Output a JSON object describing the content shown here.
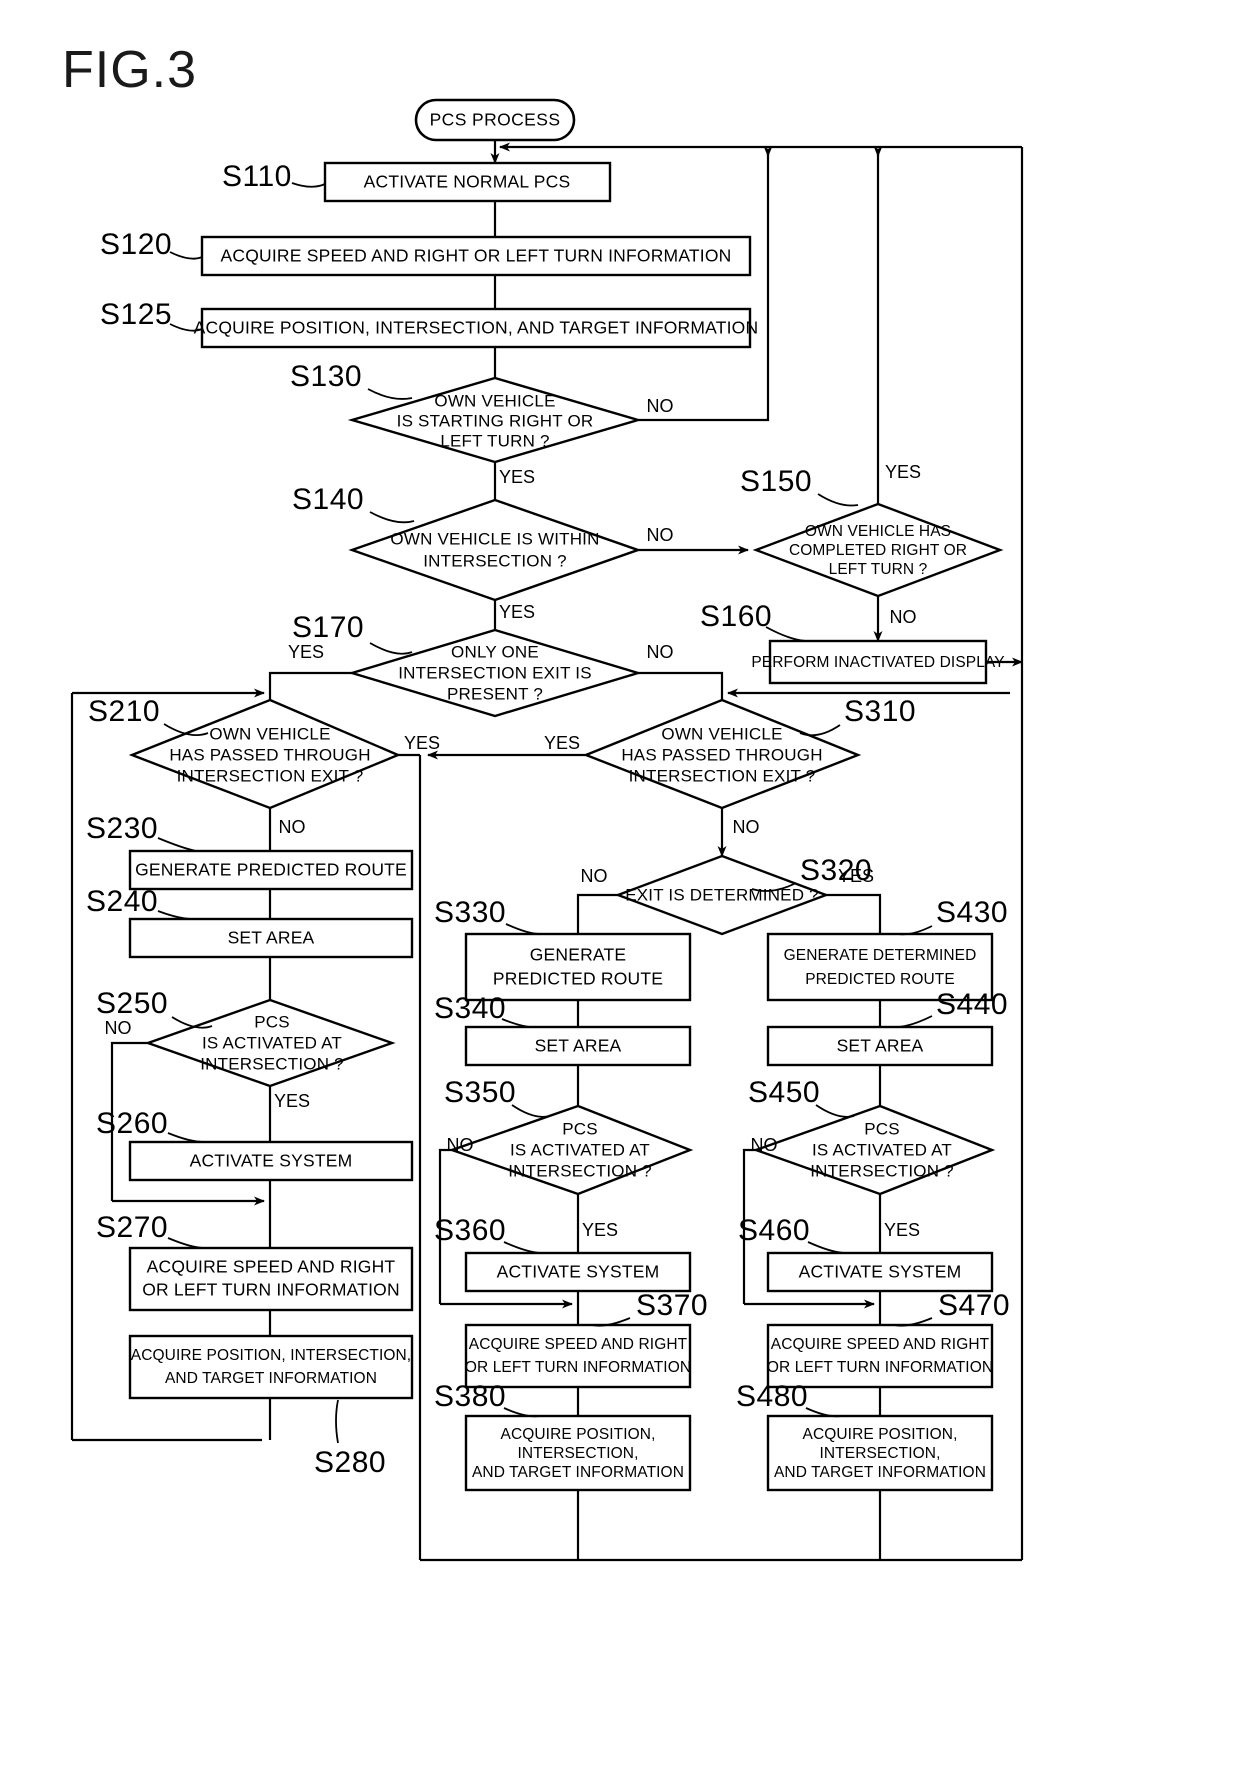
{
  "figure": {
    "title": "FIG.3",
    "type": "flowchart",
    "domain": "patent-drawing"
  },
  "labels": {
    "yes": "YES",
    "no": "NO"
  },
  "nodes": {
    "start": {
      "id": "start",
      "shape": "terminator",
      "text": "PCS PROCESS"
    },
    "s110": {
      "step": "S110",
      "shape": "process",
      "text": "ACTIVATE NORMAL PCS"
    },
    "s120": {
      "step": "S120",
      "shape": "process",
      "text": "ACQUIRE SPEED AND RIGHT OR LEFT TURN INFORMATION"
    },
    "s125": {
      "step": "S125",
      "shape": "process",
      "text": "ACQUIRE POSITION, INTERSECTION, AND TARGET INFORMATION"
    },
    "s130": {
      "step": "S130",
      "shape": "decision",
      "lines": [
        "OWN VEHICLE",
        "IS STARTING RIGHT OR",
        "LEFT TURN ?"
      ]
    },
    "s140": {
      "step": "S140",
      "shape": "decision",
      "lines": [
        "OWN VEHICLE IS WITHIN",
        "INTERSECTION ?"
      ]
    },
    "s150": {
      "step": "S150",
      "shape": "decision",
      "lines": [
        "OWN VEHICLE HAS",
        "COMPLETED RIGHT OR",
        "LEFT TURN ?"
      ]
    },
    "s160": {
      "step": "S160",
      "shape": "process",
      "text": "PERFORM INACTIVATED DISPLAY"
    },
    "s170": {
      "step": "S170",
      "shape": "decision",
      "lines": [
        "ONLY ONE",
        "INTERSECTION EXIT IS",
        "PRESENT ?"
      ]
    },
    "s210": {
      "step": "S210",
      "shape": "decision",
      "lines": [
        "OWN VEHICLE",
        "HAS PASSED THROUGH",
        "INTERSECTION EXIT ?"
      ]
    },
    "s230": {
      "step": "S230",
      "shape": "process",
      "text": "GENERATE PREDICTED ROUTE"
    },
    "s240": {
      "step": "S240",
      "shape": "process",
      "text": "SET AREA"
    },
    "s250": {
      "step": "S250",
      "shape": "decision",
      "lines": [
        "PCS",
        "IS ACTIVATED AT",
        "INTERSECTION ?"
      ]
    },
    "s260": {
      "step": "S260",
      "shape": "process",
      "text": "ACTIVATE SYSTEM"
    },
    "s270": {
      "step": "S270",
      "shape": "process",
      "lines": [
        "ACQUIRE SPEED AND RIGHT",
        "OR LEFT TURN INFORMATION"
      ]
    },
    "s280": {
      "step": "S280",
      "shape": "process",
      "lines": [
        "ACQUIRE POSITION, INTERSECTION,",
        "AND TARGET INFORMATION"
      ]
    },
    "s310": {
      "step": "S310",
      "shape": "decision",
      "lines": [
        "OWN VEHICLE",
        "HAS PASSED THROUGH",
        "INTERSECTION EXIT ?"
      ]
    },
    "s320": {
      "step": "S320",
      "shape": "decision",
      "lines": [
        "EXIT IS DETERMINED ?"
      ]
    },
    "s330": {
      "step": "S330",
      "shape": "process",
      "lines": [
        "GENERATE",
        "PREDICTED ROUTE"
      ]
    },
    "s340": {
      "step": "S340",
      "shape": "process",
      "text": "SET AREA"
    },
    "s350": {
      "step": "S350",
      "shape": "decision",
      "lines": [
        "PCS",
        "IS ACTIVATED AT",
        "INTERSECTION ?"
      ]
    },
    "s360": {
      "step": "S360",
      "shape": "process",
      "text": "ACTIVATE SYSTEM"
    },
    "s370": {
      "step": "S370",
      "shape": "process",
      "lines": [
        "ACQUIRE SPEED AND RIGHT",
        "OR LEFT TURN INFORMATION"
      ]
    },
    "s380": {
      "step": "S380",
      "shape": "process",
      "lines": [
        "ACQUIRE POSITION,",
        "INTERSECTION,",
        "AND TARGET INFORMATION"
      ]
    },
    "s430": {
      "step": "S430",
      "shape": "process",
      "lines": [
        "GENERATE DETERMINED",
        "PREDICTED ROUTE"
      ]
    },
    "s440": {
      "step": "S440",
      "shape": "process",
      "text": "SET AREA"
    },
    "s450": {
      "step": "S450",
      "shape": "decision",
      "lines": [
        "PCS",
        "IS ACTIVATED AT",
        "INTERSECTION ?"
      ]
    },
    "s460": {
      "step": "S460",
      "shape": "process",
      "text": "ACTIVATE SYSTEM"
    },
    "s470": {
      "step": "S470",
      "shape": "process",
      "lines": [
        "ACQUIRE SPEED AND RIGHT",
        "OR LEFT TURN INFORMATION"
      ]
    },
    "s480": {
      "step": "S480",
      "shape": "process",
      "lines": [
        "ACQUIRE POSITION,",
        "INTERSECTION,",
        "AND TARGET INFORMATION"
      ]
    }
  },
  "edge_labels": {
    "s130_no": "NO",
    "s130_yes": "YES",
    "s140_no": "NO",
    "s140_yes": "YES",
    "s150_yes": "YES",
    "s150_no": "NO",
    "s170_yes": "YES",
    "s170_no": "NO",
    "s210_yes": "YES",
    "s210_no": "NO",
    "s310_yes": "YES",
    "s310_no": "NO",
    "s320_no": "NO",
    "s320_yes": "YES",
    "s250_no": "NO",
    "s250_yes": "YES",
    "s350_no": "NO",
    "s350_yes": "YES",
    "s450_no": "NO",
    "s450_yes": "YES"
  }
}
